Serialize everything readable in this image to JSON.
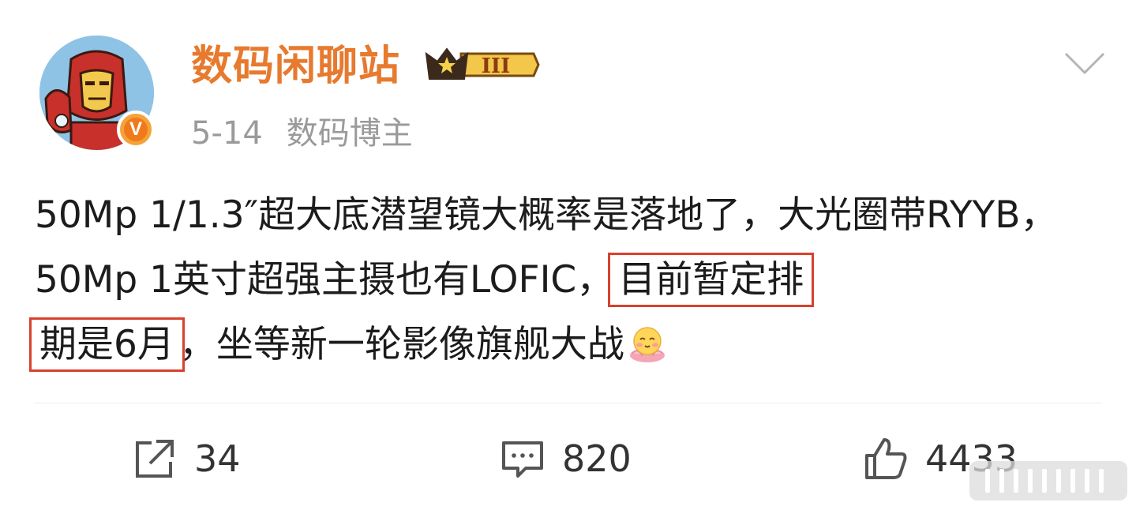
{
  "post": {
    "username": "数码闲聊站",
    "vip_level": "III",
    "date": "5-14",
    "role": "数码博主",
    "content": {
      "part1": "50Mp 1/1.3″超大底潜望镜大概率是落地了，大光圈带RYYB，50Mp 1英寸超强主摄也有LOFIC，",
      "highlight1": "目前暂定排",
      "highlight2": "期是6月",
      "part2": "，坐等新一轮影像旗舰大战"
    }
  },
  "actions": {
    "repost_count": "34",
    "comment_count": "820",
    "like_count": "4433"
  },
  "colors": {
    "username": "#e77a2e",
    "highlight_box": "#d9412e",
    "meta": "#9a9a9a"
  },
  "icons": [
    "iron-man-avatar",
    "verified-v-icon",
    "vip-crown-icon",
    "chevron-down-icon",
    "share-icon",
    "comment-icon",
    "like-icon",
    "emoji-icon"
  ]
}
